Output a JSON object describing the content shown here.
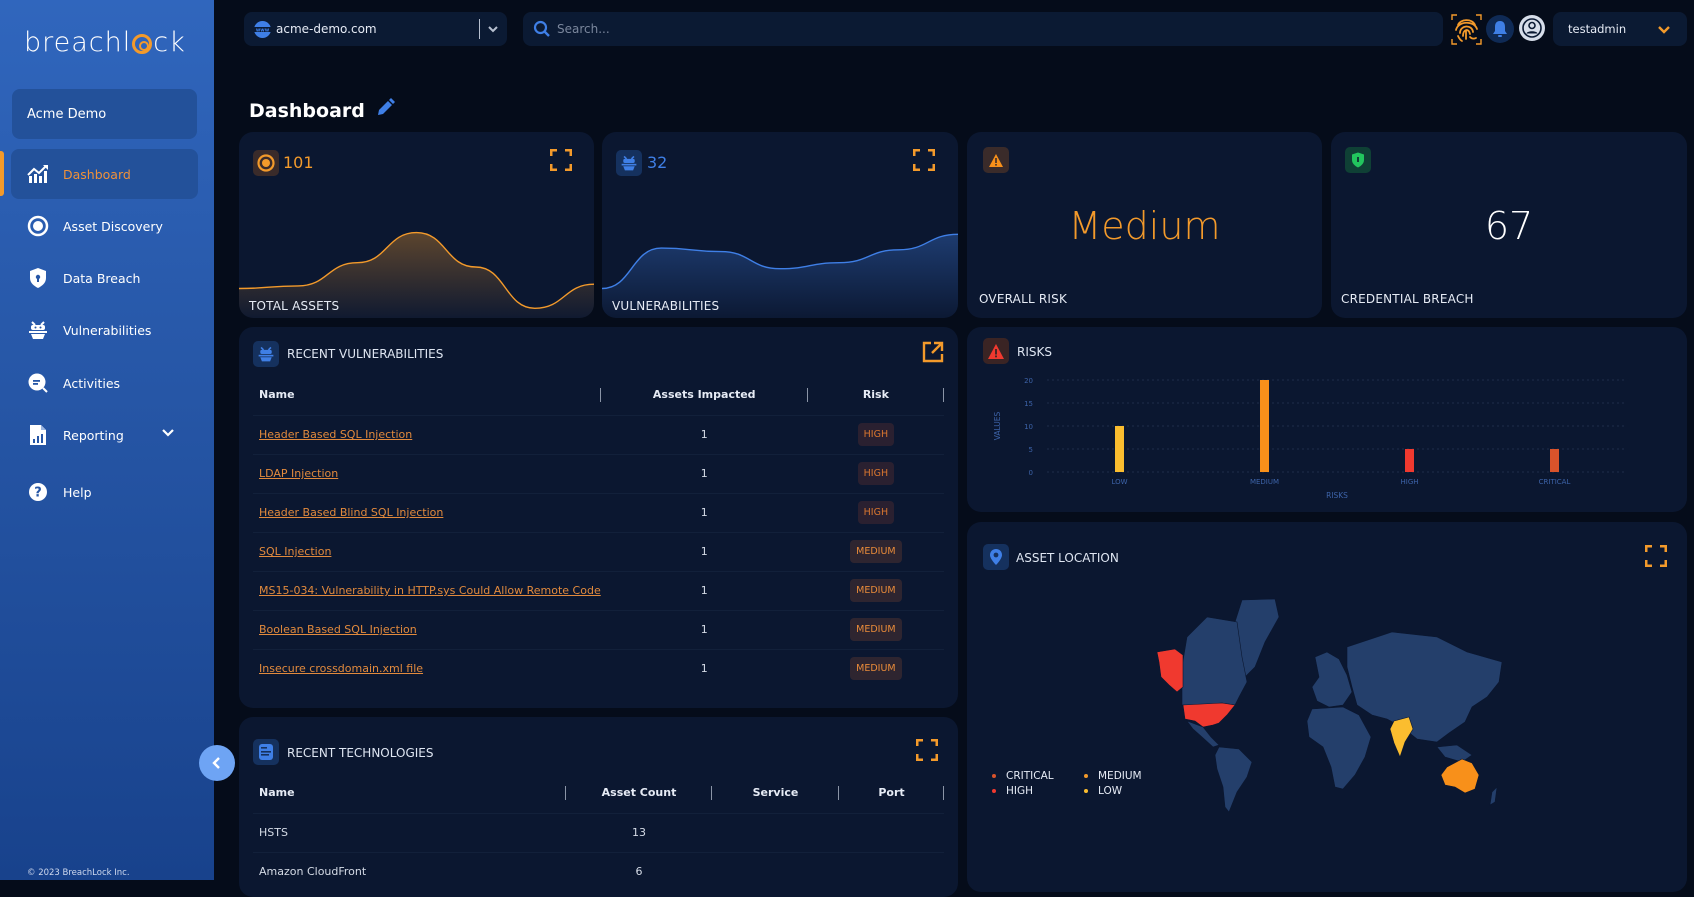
{
  "sidebar": {
    "brand": {
      "pre": "breachl",
      "post": "ck"
    },
    "org": "Acme Demo",
    "items": [
      {
        "label": "Dashboard",
        "icon": "chart-growth-icon",
        "active": true
      },
      {
        "label": "Asset Discovery",
        "icon": "target-icon"
      },
      {
        "label": "Data Breach",
        "icon": "shield-keyhole-icon"
      },
      {
        "label": "Vulnerabilities",
        "icon": "bug-icon"
      },
      {
        "label": "Activities",
        "icon": "chat-search-icon"
      },
      {
        "label": "Reporting",
        "icon": "report-icon",
        "has_submenu": true
      },
      {
        "label": "Help",
        "icon": "help-icon"
      }
    ],
    "copyright": "© 2023 BreachLock Inc.",
    "collapse_label": "‹"
  },
  "topbar": {
    "domain": "acme-demo.com",
    "search_placeholder": "Search...",
    "username": "testadmin"
  },
  "page": {
    "title": "Dashboard"
  },
  "stats": {
    "total_assets": {
      "value": "101",
      "label": "TOTAL ASSETS",
      "color": "#f39a2b"
    },
    "vulnerabilities": {
      "value": "32",
      "label": "VULNERABILITIES",
      "color": "#3f7fe6"
    },
    "overall_risk": {
      "value": "Medium",
      "label": "OVERALL RISK",
      "color": "#f39a2b"
    },
    "credential_breach": {
      "value": "67",
      "label": "CREDENTIAL BREACH",
      "color": "#ffffff"
    }
  },
  "recent_vulnerabilities": {
    "title": "RECENT VULNERABILITIES",
    "columns": [
      "Name",
      "Assets Impacted",
      "Risk"
    ],
    "rows": [
      {
        "name": "Header Based SQL Injection",
        "assets": "1",
        "risk": "HIGH"
      },
      {
        "name": "LDAP Injection",
        "assets": "1",
        "risk": "HIGH"
      },
      {
        "name": "Header Based Blind SQL Injection",
        "assets": "1",
        "risk": "HIGH"
      },
      {
        "name": "SQL Injection",
        "assets": "1",
        "risk": "MEDIUM"
      },
      {
        "name": "MS15-034: Vulnerability in HTTP.sys Could Allow Remote Code",
        "assets": "1",
        "risk": "MEDIUM"
      },
      {
        "name": "Boolean Based SQL Injection",
        "assets": "1",
        "risk": "MEDIUM"
      },
      {
        "name": "Insecure crossdomain.xml file",
        "assets": "1",
        "risk": "MEDIUM"
      }
    ]
  },
  "recent_technologies": {
    "title": "RECENT TECHNOLOGIES",
    "columns": [
      "Name",
      "Asset Count",
      "Service",
      "Port"
    ],
    "rows": [
      {
        "name": "HSTS",
        "count": "13",
        "service": "",
        "port": ""
      },
      {
        "name": "Amazon CloudFront",
        "count": "6",
        "service": "",
        "port": ""
      }
    ]
  },
  "risks_panel": {
    "title": "RISKS"
  },
  "asset_location": {
    "title": "ASSET LOCATION",
    "legend": [
      {
        "label": "CRITICAL",
        "color": "#d9532b"
      },
      {
        "label": "MEDIUM",
        "color": "#f39a2b"
      },
      {
        "label": "HIGH",
        "color": "#f0392f"
      },
      {
        "label": "LOW",
        "color": "#fbbd2f"
      }
    ],
    "highlighted_regions": [
      {
        "region": "United States",
        "level": "HIGH"
      },
      {
        "region": "India",
        "level": "LOW"
      },
      {
        "region": "Australia",
        "level": "MEDIUM"
      }
    ]
  },
  "chart_data": [
    {
      "type": "bar",
      "title": "RISKS",
      "categories": [
        "LOW",
        "MEDIUM",
        "HIGH",
        "CRITICAL"
      ],
      "values": [
        10,
        20,
        5,
        5
      ],
      "colors": [
        "#fbbd2f",
        "#f8901a",
        "#f0392f",
        "#d9532b"
      ],
      "xlabel": "RISKS",
      "ylabel": "VALUES",
      "ylim": [
        0,
        20
      ],
      "yticks": [
        0,
        5,
        10,
        15,
        20
      ],
      "grid": true
    },
    {
      "type": "area",
      "title": "TOTAL ASSETS",
      "x": [
        0,
        1,
        2,
        3,
        4,
        5,
        6
      ],
      "values": [
        0.25,
        0.28,
        0.55,
        0.9,
        0.5,
        0.02,
        0.3
      ],
      "color": "#f39a2b"
    },
    {
      "type": "area",
      "title": "VULNERABILITIES",
      "x": [
        0,
        1,
        2,
        3,
        4,
        5,
        6
      ],
      "values": [
        0.25,
        0.72,
        0.68,
        0.48,
        0.55,
        0.7,
        0.88
      ],
      "color": "#3f7fe6"
    }
  ]
}
